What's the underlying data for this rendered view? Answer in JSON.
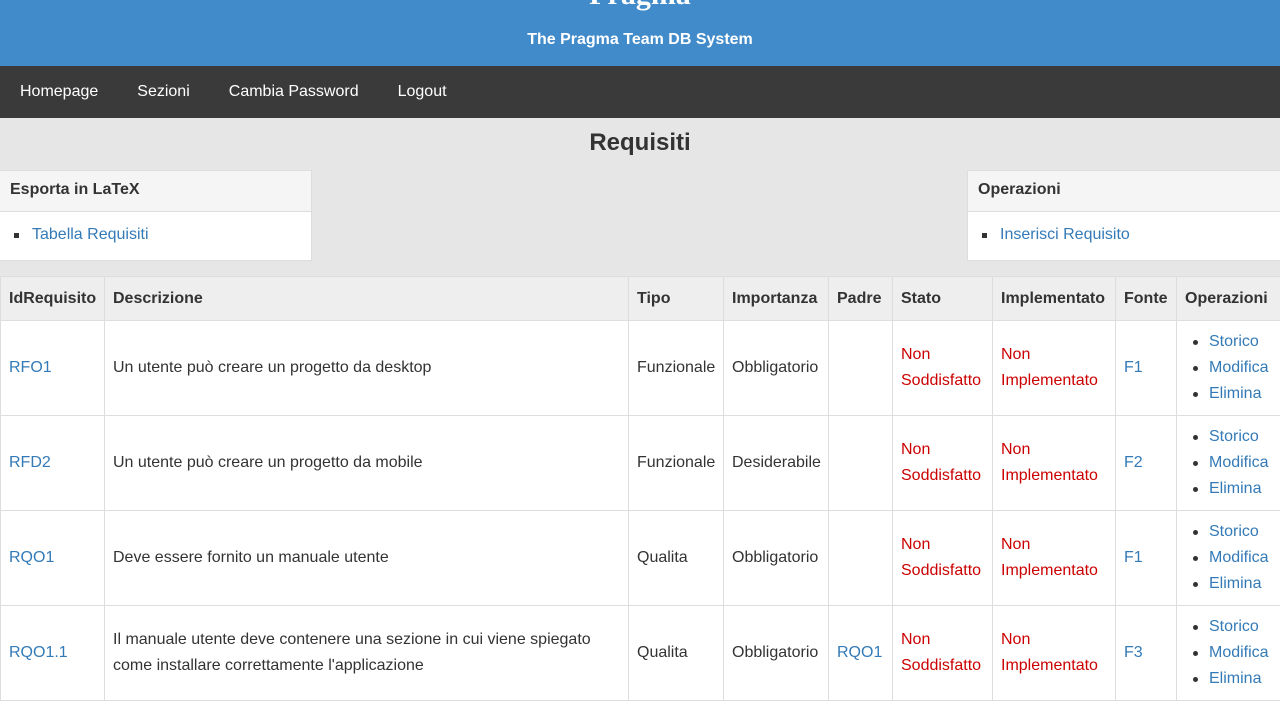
{
  "header": {
    "brand": "Pragma",
    "subtitle": "The Pragma Team DB System"
  },
  "nav": {
    "items": [
      "Homepage",
      "Sezioni",
      "Cambia Password",
      "Logout"
    ]
  },
  "page": {
    "title": "Requisiti"
  },
  "export_panel": {
    "title": "Esporta in LaTeX",
    "links": [
      "Tabella Requisiti"
    ]
  },
  "ops_panel": {
    "title": "Operazioni",
    "links": [
      "Inserisci Requisito"
    ]
  },
  "table": {
    "headers": [
      "IdRequisito",
      "Descrizione",
      "Tipo",
      "Importanza",
      "Padre",
      "Stato",
      "Implementato",
      "Fonte",
      "Operazioni"
    ],
    "rows": [
      {
        "id": "RFO1",
        "descrizione": "Un utente può creare un progetto da desktop",
        "tipo": "Funzionale",
        "importanza": "Obbligatorio",
        "padre": "",
        "stato": "Non Soddisfatto",
        "implementato": "Non Implementato",
        "fonte": "F1",
        "ops": [
          "Storico",
          "Modifica",
          "Elimina"
        ]
      },
      {
        "id": "RFD2",
        "descrizione": "Un utente può creare un progetto da mobile",
        "tipo": "Funzionale",
        "importanza": "Desiderabile",
        "padre": "",
        "stato": "Non Soddisfatto",
        "implementato": "Non Implementato",
        "fonte": "F2",
        "ops": [
          "Storico",
          "Modifica",
          "Elimina"
        ]
      },
      {
        "id": "RQO1",
        "descrizione": "Deve essere fornito un manuale utente",
        "tipo": "Qualita",
        "importanza": "Obbligatorio",
        "padre": "",
        "stato": "Non Soddisfatto",
        "implementato": "Non Implementato",
        "fonte": "F1",
        "ops": [
          "Storico",
          "Modifica",
          "Elimina"
        ]
      },
      {
        "id": "RQO1.1",
        "descrizione": "Il manuale utente deve contenere una sezione in cui viene spiegato come installare correttamente l'applicazione",
        "tipo": "Qualita",
        "importanza": "Obbligatorio",
        "padre": "RQO1",
        "stato": "Non Soddisfatto",
        "implementato": "Non Implementato",
        "fonte": "F3",
        "ops": [
          "Storico",
          "Modifica",
          "Elimina"
        ]
      }
    ]
  },
  "colors": {
    "header_bg": "#428bca",
    "nav_bg": "#3a3a3a",
    "link": "#337ab7",
    "status_red": "#cc0000"
  }
}
